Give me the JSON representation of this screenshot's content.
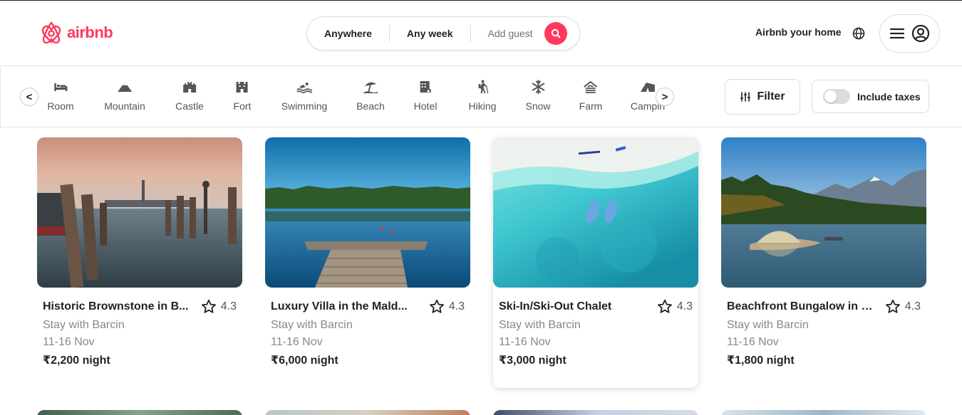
{
  "brand": {
    "name": "airbnb",
    "color": "#ff385c"
  },
  "search": {
    "where_label": "Anywhere",
    "when_label": "Any week",
    "guest_label": "Add guest"
  },
  "header": {
    "host_link": "Airbnb your home"
  },
  "categories": [
    {
      "label": "Room",
      "icon": "bed-icon"
    },
    {
      "label": "Mountain",
      "icon": "mountain-icon"
    },
    {
      "label": "Castle",
      "icon": "castle-icon"
    },
    {
      "label": "Fort",
      "icon": "fort-icon"
    },
    {
      "label": "Swimming",
      "icon": "swimming-icon"
    },
    {
      "label": "Beach",
      "icon": "beach-umbrella-icon"
    },
    {
      "label": "Hotel",
      "icon": "hotel-icon"
    },
    {
      "label": "Hiking",
      "icon": "hiking-icon"
    },
    {
      "label": "Snow",
      "icon": "snowflake-icon"
    },
    {
      "label": "Farm",
      "icon": "farm-icon"
    },
    {
      "label": "Campin",
      "icon": "tent-icon"
    }
  ],
  "filters": {
    "filter_label": "Filter",
    "taxes_label": "Include taxes",
    "taxes_on": false
  },
  "listings": [
    {
      "title": "Historic Brownstone in B...",
      "rating": "4.3",
      "subtitle": "Stay with Barcin",
      "dates": "11-16 Nov",
      "price": "₹2,200 night"
    },
    {
      "title": "Luxury Villa in the Mald...",
      "rating": "4.3",
      "subtitle": "Stay with Barcin",
      "dates": "11-16 Nov",
      "price": "₹6,000 night"
    },
    {
      "title": "Ski-In/Ski-Out Chalet",
      "rating": "4.3",
      "subtitle": "Stay with Barcin",
      "dates": "11-16 Nov",
      "price": "₹3,000 night"
    },
    {
      "title": "Beachfront Bungalow in B...",
      "rating": "4.3",
      "subtitle": "Stay with Barcin",
      "dates": "11-16 Nov",
      "price": "₹1,800 night"
    }
  ]
}
